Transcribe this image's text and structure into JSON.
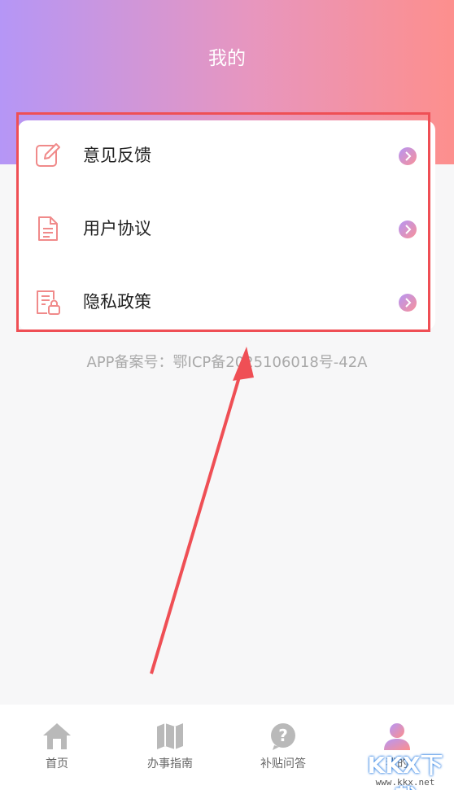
{
  "header": {
    "title": "我的"
  },
  "menu": {
    "items": [
      {
        "label": "意见反馈",
        "icon": "edit-icon"
      },
      {
        "label": "用户协议",
        "icon": "document-icon"
      },
      {
        "label": "隐私政策",
        "icon": "privacy-lock-document-icon"
      }
    ]
  },
  "icp": {
    "text": "APP备案号：鄂ICP备2025106018号-42A"
  },
  "tabbar": {
    "tabs": [
      {
        "label": "首页",
        "icon": "home-icon",
        "active": false
      },
      {
        "label": "办事指南",
        "icon": "map-icon",
        "active": false
      },
      {
        "label": "补贴问答",
        "icon": "question-bubble-icon",
        "active": false
      },
      {
        "label": "我的",
        "icon": "user-icon",
        "active": true
      }
    ]
  },
  "watermark": {
    "text": "KKX下载",
    "url": "www.kkx.net"
  },
  "colors": {
    "gradient_start": "#b596f6",
    "gradient_end": "#fd8f8d",
    "icon_pink": "#f08a8a",
    "highlight_red": "#ef4f55"
  }
}
